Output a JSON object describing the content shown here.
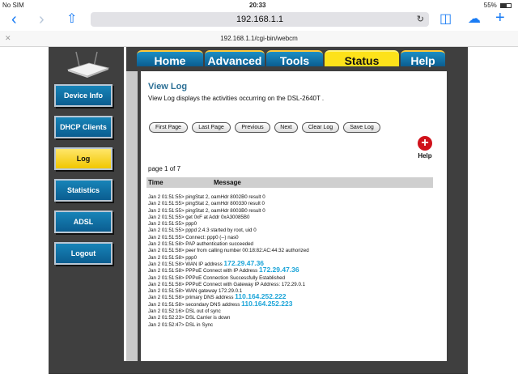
{
  "statusbar": {
    "carrier": "No SIM",
    "time": "20:33",
    "battery": "55%",
    "battery_level": 0.55
  },
  "browser": {
    "address": "192.168.1.1",
    "page_url": "192.168.1.1/cgi-bin/webcm"
  },
  "sidebar": {
    "items": [
      {
        "label": "Device Info"
      },
      {
        "label": "DHCP Clients"
      },
      {
        "label": "Log"
      },
      {
        "label": "Statistics"
      },
      {
        "label": "ADSL"
      },
      {
        "label": "Logout"
      }
    ],
    "active": "Log"
  },
  "tabs": [
    {
      "label": "Home"
    },
    {
      "label": "Advanced"
    },
    {
      "label": "Tools"
    },
    {
      "label": "Status"
    },
    {
      "label": "Help"
    }
  ],
  "content": {
    "title": "View Log",
    "description": "View Log displays the activities occurring on the DSL-2640T .",
    "buttons": [
      "First Page",
      "Last Page",
      "Previous",
      "Next",
      "Clear Log",
      "Save Log"
    ],
    "help_label": "Help",
    "page_info": "page 1 of 7",
    "columns": {
      "time": "Time",
      "message": "Message"
    }
  },
  "log": [
    {
      "text": "Jan 2 01:51:55> pingStat 2, oamHdr 8002B0 result 0",
      "ip": ""
    },
    {
      "text": "Jan 2 01:51:55> pingStat 2, oamHdr 800330 result 0",
      "ip": ""
    },
    {
      "text": "Jan 2 01:51:55> pingStat 2, oamHdr 8003B0 result 0",
      "ip": ""
    },
    {
      "text": "Jan 2 01:51:55> get 0xF at Addr 0xA30085B0",
      "ip": ""
    },
    {
      "text": "Jan 2 01:51:55> ppp0",
      "ip": ""
    },
    {
      "text": "Jan 2 01:51:55> pppd 2.4.3 started by root, uid 0",
      "ip": ""
    },
    {
      "text": "Jan 2 01:51:55> Connect: ppp0 (--) nas0",
      "ip": ""
    },
    {
      "text": "Jan 2 01:51:58> PAP authentication succeeded",
      "ip": ""
    },
    {
      "text": "Jan 2 01:51:58> peer from calling number 00:18:82:AC:44:32 authorized",
      "ip": ""
    },
    {
      "text": "Jan 2 01:51:58> ppp0",
      "ip": ""
    },
    {
      "text": "Jan 2 01:51:58> WAN IP address",
      "ip": "172.29.47.36"
    },
    {
      "text": "Jan 2 01:51:58> PPPoE Connect with IP Address",
      "ip": "172.29.47.36"
    },
    {
      "text": "Jan 2 01:51:58> PPPoE Connection Successfully Established",
      "ip": ""
    },
    {
      "text": "Jan 2 01:51:58> PPPoE Connect with Gateway IP Address: 172.29.0.1",
      "ip": ""
    },
    {
      "text": "Jan 2 01:51:58> WAN gateway 172.29.0.1",
      "ip": ""
    },
    {
      "text": "Jan 2 01:51:58> primary DNS address",
      "ip": "110.164.252.222"
    },
    {
      "text": "Jan 2 01:51:58> secondary DNS address",
      "ip": "110.164.252.223"
    },
    {
      "text": "Jan 2 01:52:16> DSL out of sync",
      "ip": ""
    },
    {
      "text": "Jan 2 01:52:23> DSL Carrier is down",
      "ip": ""
    },
    {
      "text": "Jan 2 01:52:47> DSL in Sync",
      "ip": ""
    }
  ]
}
